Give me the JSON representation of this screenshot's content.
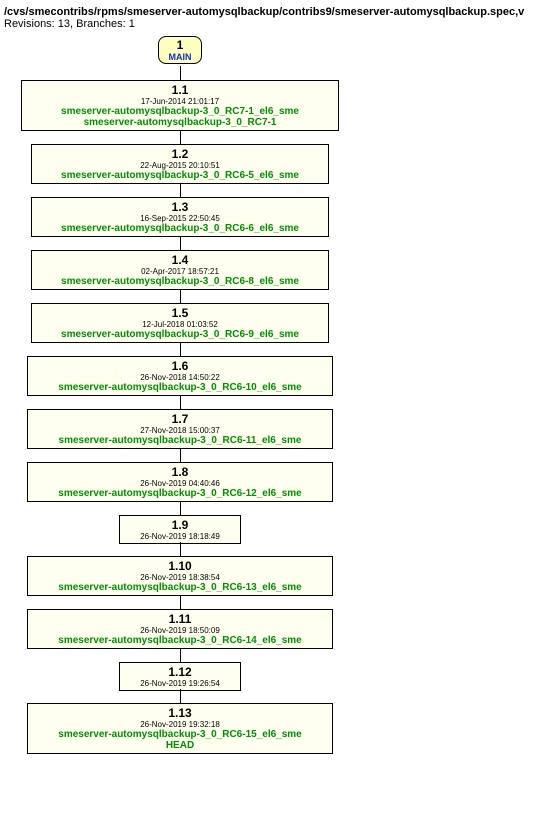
{
  "header": {
    "path": "/cvs/smecontribs/rpms/smeserver-automysqlbackup/contribs9/smeserver-automysqlbackup.spec,v",
    "revisions": "Revisions: 13, Branches: 1"
  },
  "chart_data": {
    "type": "tree",
    "root_branch": {
      "rev": "1",
      "name": "MAIN"
    },
    "revisions": [
      {
        "rev": "1.1",
        "date": "17-Jun-2014 21:01:17",
        "tags": [
          "smeserver-automysqlbackup-3_0_RC7-1_el6_sme",
          "smeserver-automysqlbackup-3_0_RC7-1"
        ]
      },
      {
        "rev": "1.2",
        "date": "22-Aug-2015 20:10:51",
        "tags": [
          "smeserver-automysqlbackup-3_0_RC6-5_el6_sme"
        ]
      },
      {
        "rev": "1.3",
        "date": "16-Sep-2015 22:50:45",
        "tags": [
          "smeserver-automysqlbackup-3_0_RC6-6_el6_sme"
        ]
      },
      {
        "rev": "1.4",
        "date": "02-Apr-2017 18:57:21",
        "tags": [
          "smeserver-automysqlbackup-3_0_RC6-8_el6_sme"
        ]
      },
      {
        "rev": "1.5",
        "date": "12-Jul-2018 01:03:52",
        "tags": [
          "smeserver-automysqlbackup-3_0_RC6-9_el6_sme"
        ]
      },
      {
        "rev": "1.6",
        "date": "26-Nov-2018 14:50:22",
        "tags": [
          "smeserver-automysqlbackup-3_0_RC6-10_el6_sme"
        ]
      },
      {
        "rev": "1.7",
        "date": "27-Nov-2018 15:00:37",
        "tags": [
          "smeserver-automysqlbackup-3_0_RC6-11_el6_sme"
        ]
      },
      {
        "rev": "1.8",
        "date": "26-Nov-2019 04:40:46",
        "tags": [
          "smeserver-automysqlbackup-3_0_RC6-12_el6_sme"
        ]
      },
      {
        "rev": "1.9",
        "date": "26-Nov-2019 18:18:49",
        "tags": []
      },
      {
        "rev": "1.10",
        "date": "26-Nov-2019 18:38:54",
        "tags": [
          "smeserver-automysqlbackup-3_0_RC6-13_el6_sme"
        ]
      },
      {
        "rev": "1.11",
        "date": "26-Nov-2019 18:50:09",
        "tags": [
          "smeserver-automysqlbackup-3_0_RC6-14_el6_sme"
        ]
      },
      {
        "rev": "1.12",
        "date": "26-Nov-2019 19:26:54",
        "tags": []
      },
      {
        "rev": "1.13",
        "date": "26-Nov-2019 19:32:18",
        "tags": [
          "smeserver-automysqlbackup-3_0_RC6-15_el6_sme",
          "HEAD"
        ]
      }
    ]
  }
}
